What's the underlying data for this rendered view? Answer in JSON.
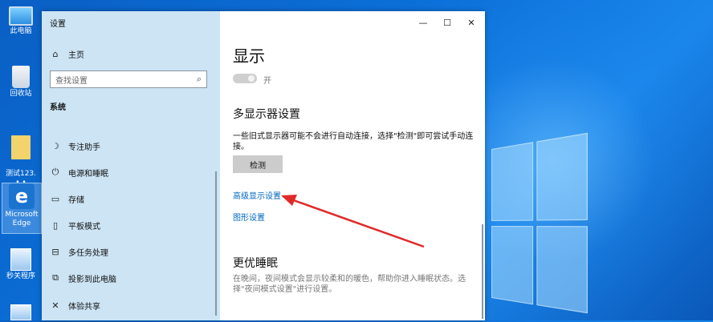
{
  "desktop": {
    "icons": [
      {
        "label": "此电脑"
      },
      {
        "label": "回收站"
      },
      {
        "label": "测试123.\n• •"
      },
      {
        "label": "Microsoft Edge"
      },
      {
        "label": "秒关程序"
      }
    ]
  },
  "window": {
    "title": "设置",
    "controls": {
      "minimize": "—",
      "maximize": "☐",
      "close": "✕"
    }
  },
  "sidebar": {
    "home": "主页",
    "search_placeholder": "查找设置",
    "section": "系统",
    "items": [
      {
        "label": "专注助手",
        "icon": "moon-icon"
      },
      {
        "label": "电源和睡眠",
        "icon": "power-icon"
      },
      {
        "label": "存储",
        "icon": "storage-icon"
      },
      {
        "label": "平板模式",
        "icon": "tablet-icon"
      },
      {
        "label": "多任务处理",
        "icon": "multitask-icon"
      },
      {
        "label": "投影到此电脑",
        "icon": "project-icon"
      },
      {
        "label": "体验共享",
        "icon": "share-icon"
      }
    ]
  },
  "main": {
    "page_title": "显示",
    "toggle_label": "开",
    "multi_display_heading": "多显示器设置",
    "multi_display_desc": "一些旧式显示器可能不会进行自动连接，选择\"检测\"即可尝试手动连接。",
    "detect_button": "检测",
    "advanced_link": "高级显示设置",
    "graphics_link": "图形设置",
    "sleep_heading": "更优睡眠",
    "sleep_desc": "在晚间，夜间模式会显示较柔和的暖色，帮助你进入睡眠状态。选择\"夜间模式设置\"进行设置。"
  },
  "colors": {
    "accent": "#0067c0",
    "annotation_arrow": "#e02a2a"
  }
}
